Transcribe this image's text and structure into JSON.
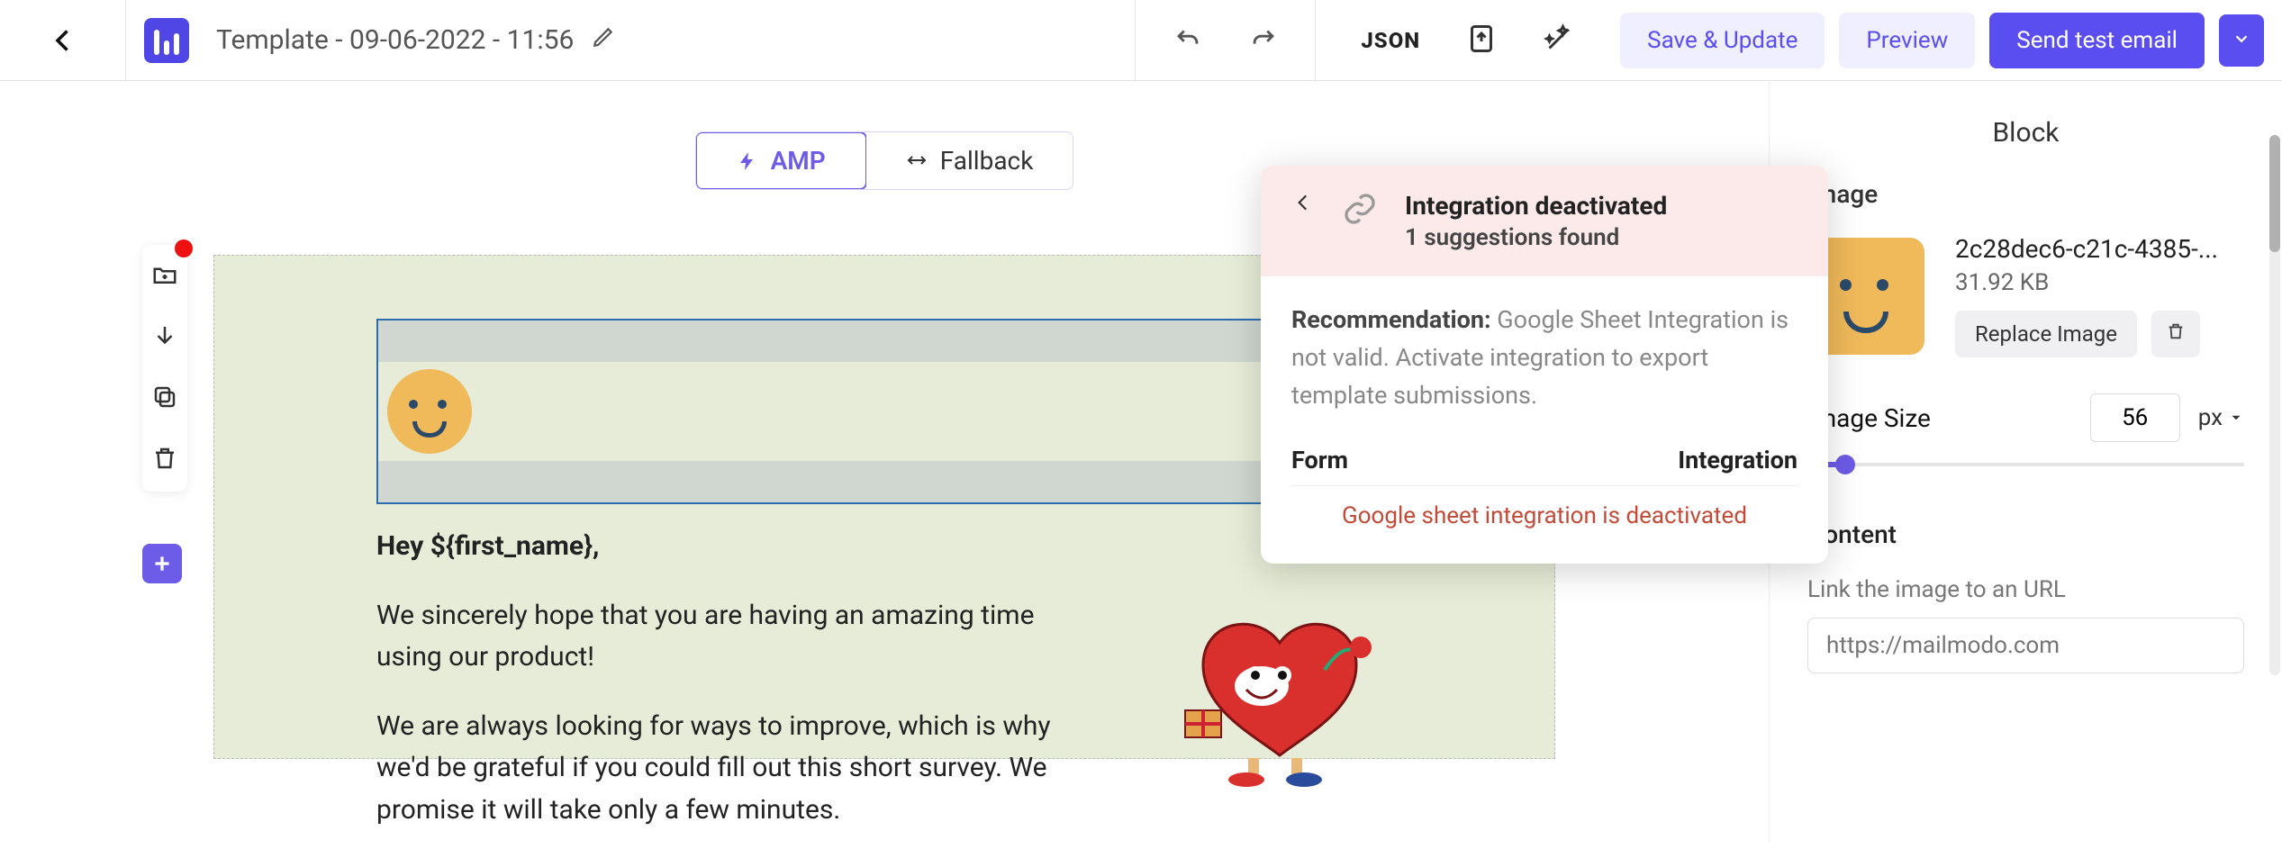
{
  "header": {
    "title": "Template - 09-06-2022 - 11:56",
    "json_label": "JSON",
    "save_label": "Save & Update",
    "preview_label": "Preview",
    "send_test_label": "Send test email"
  },
  "tabs": {
    "amp": "AMP",
    "fallback": "Fallback"
  },
  "email": {
    "greeting": "Hey ${first_name},",
    "p1": "We sincerely hope that you are having an amazing time using our product!",
    "p2": "We are always looking for ways to improve, which is why we'd be grateful if you could fill out this short survey. We promise it will take only a few minutes."
  },
  "popover": {
    "title": "Integration deactivated",
    "subtitle": "1 suggestions found",
    "recommendation_label": "Recommendation:",
    "recommendation_text": " Google Sheet Integration is not valid. Activate integration to export template submissions.",
    "col_form": "Form",
    "col_integration": "Integration",
    "deactivated_msg": "Google sheet integration is deactivated"
  },
  "right_panel": {
    "block_heading": "Block",
    "section_image": "Image",
    "image_name": "2c28dec6-c21c-4385-...",
    "image_size": "31.92 KB",
    "replace_label": "Replace Image",
    "size_label": "Image Size",
    "size_value": "56",
    "size_unit": "px",
    "content_heading": "Content",
    "link_label": "Link the image to an URL",
    "link_placeholder": "https://mailmodo.com"
  }
}
